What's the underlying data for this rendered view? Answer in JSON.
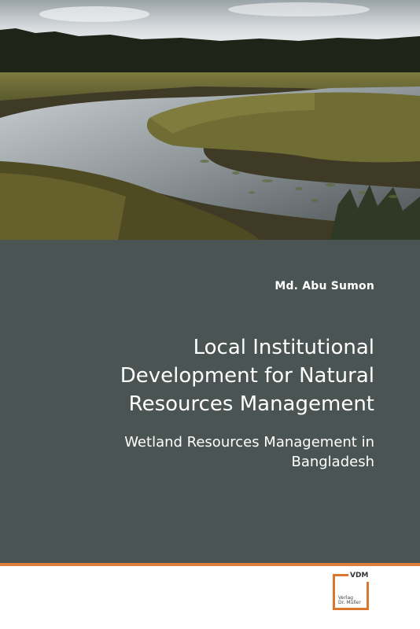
{
  "cover": {
    "author": "Md. Abu Sumon",
    "title_lines": [
      "Local Institutional",
      "Development for Natural",
      "Resources Management"
    ],
    "subtitle_lines": [
      "Wetland Resources Management in",
      "Bangladesh"
    ]
  },
  "publisher": {
    "logo_text": "VDM",
    "imprint_lines": [
      "Verlag",
      "Dr. Müller"
    ]
  },
  "colors": {
    "panel": "#4a5452",
    "accent": "#e07f3a",
    "text": "#ffffff"
  },
  "image": {
    "subject": "wetland-marsh-photo"
  }
}
